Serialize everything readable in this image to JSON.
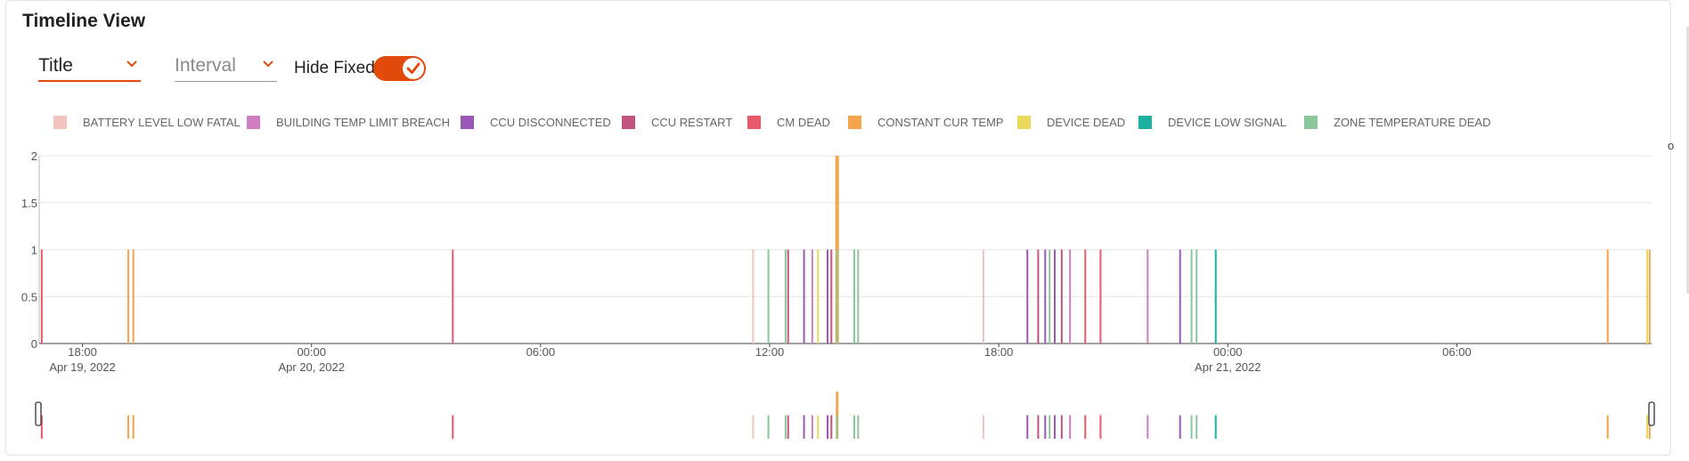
{
  "page": {
    "title": "Timeline View"
  },
  "controls": {
    "title_select": {
      "value": "Title"
    },
    "interval_select": {
      "placeholder": "Interval"
    },
    "hide_fixed": {
      "label": "Hide Fixed",
      "checked": true
    },
    "right_edge_glyph": "o"
  },
  "colors": {
    "accent": "#e24a0c"
  },
  "chart_data": {
    "type": "bar",
    "title": "",
    "xlabel": "",
    "ylabel": "",
    "ylim": [
      0,
      2
    ],
    "yticks": [
      "0",
      "0.5",
      "1",
      "1.5",
      "2"
    ],
    "x_range": [
      "2022-04-19T16:52",
      "2022-04-21T11:06"
    ],
    "xticks": [
      {
        "time": "2022-04-19T18:00",
        "label": "18:00",
        "date": "Apr 19, 2022"
      },
      {
        "time": "2022-04-20T00:00",
        "label": "00:00",
        "date": "Apr 20, 2022"
      },
      {
        "time": "2022-04-20T06:00",
        "label": "06:00",
        "date": ""
      },
      {
        "time": "2022-04-20T12:00",
        "label": "12:00",
        "date": ""
      },
      {
        "time": "2022-04-20T18:00",
        "label": "18:00",
        "date": ""
      },
      {
        "time": "2022-04-21T00:00",
        "label": "00:00",
        "date": "Apr 21, 2022"
      },
      {
        "time": "2022-04-21T06:00",
        "label": "06:00",
        "date": ""
      }
    ],
    "grid": true,
    "legend_position": "top",
    "series": [
      {
        "name": "BATTERY LEVEL LOW FATAL",
        "color": "#f2c4c0",
        "points": [
          [
            "2022-04-20T11:34",
            1
          ],
          [
            "2022-04-20T13:46",
            1
          ],
          [
            "2022-04-20T17:36",
            1
          ]
        ]
      },
      {
        "name": "BUILDING TEMP LIMIT BREACH",
        "color": "#cf7fbf",
        "points": [
          [
            "2022-04-20T13:07",
            1
          ],
          [
            "2022-04-20T19:52",
            1
          ],
          [
            "2022-04-20T21:54",
            1
          ]
        ]
      },
      {
        "name": "CCU DISCONNECTED",
        "color": "#9b59b6",
        "points": [
          [
            "2022-04-20T12:54",
            1
          ],
          [
            "2022-04-20T13:31",
            1
          ],
          [
            "2022-04-20T18:45",
            1
          ],
          [
            "2022-04-20T19:13",
            1
          ],
          [
            "2022-04-20T19:28",
            1
          ],
          [
            "2022-04-20T22:45",
            1
          ]
        ]
      },
      {
        "name": "CCU RESTART",
        "color": "#c2547e",
        "points": [
          [
            "2022-04-20T12:29",
            1
          ],
          [
            "2022-04-20T13:37",
            1
          ],
          [
            "2022-04-20T19:02",
            1
          ],
          [
            "2022-04-20T19:39",
            1
          ]
        ]
      },
      {
        "name": "CM DEAD",
        "color": "#e85a6a",
        "points": [
          [
            "2022-04-19T16:56",
            1
          ],
          [
            "2022-04-20T03:42",
            1
          ],
          [
            "2022-04-20T20:16",
            1
          ],
          [
            "2022-04-20T20:40",
            1
          ]
        ]
      },
      {
        "name": "CONSTANT CUR TEMP",
        "color": "#f5a54b",
        "points": [
          [
            "2022-04-19T19:12",
            1
          ],
          [
            "2022-04-19T19:20",
            1
          ],
          [
            "2022-04-20T13:46",
            2
          ],
          [
            "2022-04-21T09:57",
            1
          ],
          [
            "2022-04-21T11:03",
            1
          ]
        ]
      },
      {
        "name": "DEVICE DEAD",
        "color": "#ead95a",
        "points": [
          [
            "2022-04-20T13:16",
            1
          ],
          [
            "2022-04-21T10:59",
            1
          ]
        ]
      },
      {
        "name": "DEVICE LOW SIGNAL",
        "color": "#1fb1a0",
        "points": [
          [
            "2022-04-20T23:41",
            1
          ]
        ]
      },
      {
        "name": "ZONE TEMPERATURE DEAD",
        "color": "#8ac79a",
        "points": [
          [
            "2022-04-20T11:58",
            1
          ],
          [
            "2022-04-20T12:25",
            1
          ],
          [
            "2022-04-20T13:46",
            1
          ],
          [
            "2022-04-20T14:13",
            1
          ],
          [
            "2022-04-20T14:19",
            1
          ],
          [
            "2022-04-20T19:20",
            1
          ],
          [
            "2022-04-20T23:03",
            1
          ],
          [
            "2022-04-20T23:11",
            1
          ]
        ]
      }
    ]
  }
}
